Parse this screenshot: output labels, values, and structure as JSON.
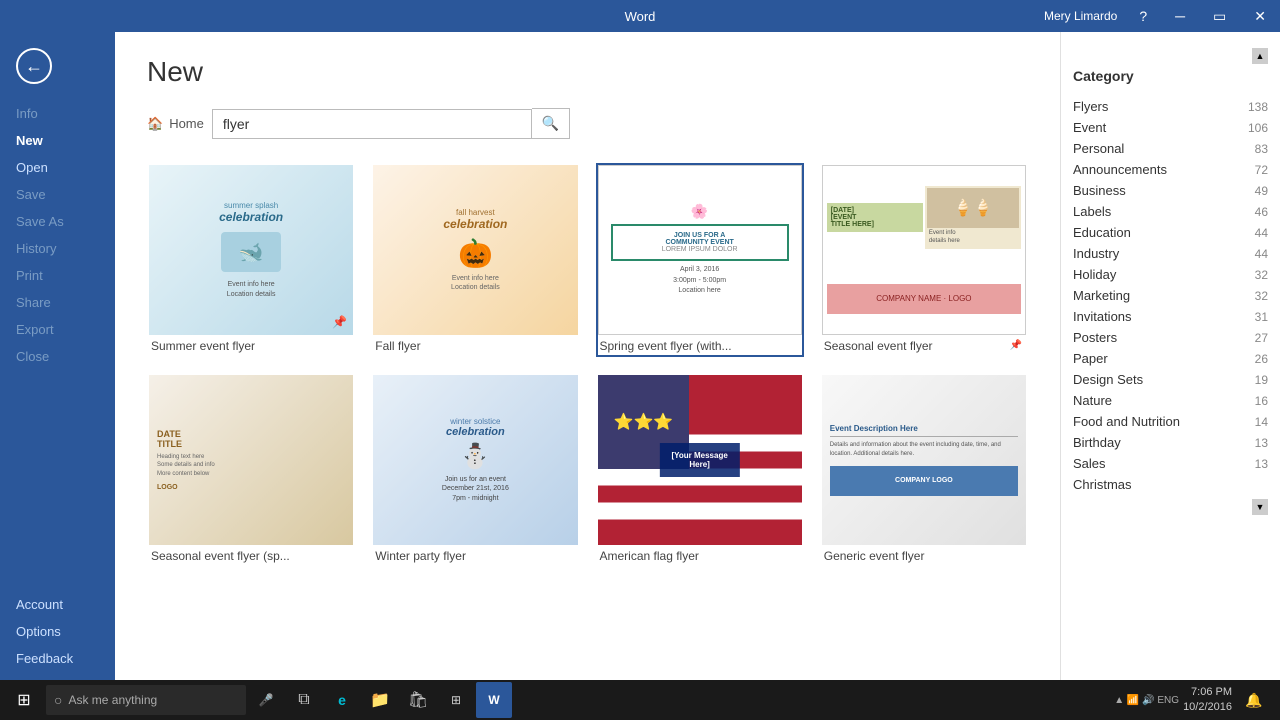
{
  "titlebar": {
    "app_name": "Word",
    "user_name": "Mery Limardo",
    "help_icon": "?",
    "minimize_icon": "─",
    "maximize_icon": "▭",
    "close_icon": "✕"
  },
  "sidebar": {
    "back_icon": "←",
    "nav_items": [
      {
        "id": "info",
        "label": "Info",
        "state": "normal"
      },
      {
        "id": "new",
        "label": "New",
        "state": "active"
      },
      {
        "id": "open",
        "label": "Open",
        "state": "normal"
      },
      {
        "id": "save",
        "label": "Save",
        "state": "disabled"
      },
      {
        "id": "save-as",
        "label": "Save As",
        "state": "disabled"
      },
      {
        "id": "history",
        "label": "History",
        "state": "disabled"
      },
      {
        "id": "print",
        "label": "Print",
        "state": "disabled"
      },
      {
        "id": "share",
        "label": "Share",
        "state": "disabled"
      },
      {
        "id": "export",
        "label": "Export",
        "state": "disabled"
      },
      {
        "id": "close",
        "label": "Close",
        "state": "disabled"
      }
    ],
    "bottom_items": [
      {
        "id": "account",
        "label": "Account"
      },
      {
        "id": "options",
        "label": "Options"
      },
      {
        "id": "feedback",
        "label": "Feedback"
      }
    ]
  },
  "main": {
    "title": "New",
    "search": {
      "home_label": "Home",
      "placeholder": "flyer",
      "search_icon": "🔍"
    }
  },
  "templates": [
    {
      "id": "summer",
      "label": "Summer event flyer",
      "style": "card-summer",
      "pinned": true,
      "content": "summer splash\ncelebration"
    },
    {
      "id": "fall",
      "label": "Fall flyer",
      "style": "card-fall",
      "pinned": false,
      "content": "fall harvest\ncelebration"
    },
    {
      "id": "spring",
      "label": "Spring event flyer (with...",
      "style": "card-spring",
      "pinned": false,
      "content": "COMMUNITY EVENT\nLOREM IPSUM DOLOR"
    },
    {
      "id": "seasonal",
      "label": "Seasonal event flyer",
      "style": "card-seasonal",
      "pinned": true,
      "content": "[DATE]\n[EVENT TITLE HERE]"
    },
    {
      "id": "seasonal2",
      "label": "Seasonal event flyer (sp...",
      "style": "card-seasonal2",
      "pinned": false,
      "content": "DATE\nTITLE"
    },
    {
      "id": "winter",
      "label": "Winter party flyer",
      "style": "card-winter",
      "pinned": false,
      "content": "winter solstice\ncelebration"
    },
    {
      "id": "flag",
      "label": "American flag flyer",
      "style": "card-flag",
      "pinned": false,
      "content": "[Your Message Here]"
    },
    {
      "id": "generic",
      "label": "Generic event flyer",
      "style": "card-generic",
      "pinned": false,
      "content": "Event Description\nDetails Here"
    }
  ],
  "categories": {
    "title": "Category",
    "items": [
      {
        "label": "Flyers",
        "count": 138
      },
      {
        "label": "Event",
        "count": 106
      },
      {
        "label": "Personal",
        "count": 83
      },
      {
        "label": "Announcements",
        "count": 72
      },
      {
        "label": "Business",
        "count": 49
      },
      {
        "label": "Labels",
        "count": 46
      },
      {
        "label": "Education",
        "count": 44
      },
      {
        "label": "Industry",
        "count": 44
      },
      {
        "label": "Holiday",
        "count": 32
      },
      {
        "label": "Marketing",
        "count": 32
      },
      {
        "label": "Invitations",
        "count": 31
      },
      {
        "label": "Posters",
        "count": 27
      },
      {
        "label": "Paper",
        "count": 26
      },
      {
        "label": "Design Sets",
        "count": 19
      },
      {
        "label": "Nature",
        "count": 16
      },
      {
        "label": "Food and Nutrition",
        "count": 14
      },
      {
        "label": "Birthday",
        "count": 13
      },
      {
        "label": "Sales",
        "count": 13
      },
      {
        "label": "Christmas",
        "count": ""
      }
    ]
  },
  "taskbar": {
    "start_icon": "⊞",
    "search_placeholder": "Ask me anything",
    "search_icon": "○",
    "mic_icon": "🎤",
    "task_view_icon": "⧉",
    "edge_icon": "e",
    "folder_icon": "📁",
    "store_icon": "🛍",
    "apps_icon": "⊞",
    "word_icon": "W",
    "time": "7:06 PM",
    "date": "10/2/2016",
    "lang": "ENG"
  }
}
